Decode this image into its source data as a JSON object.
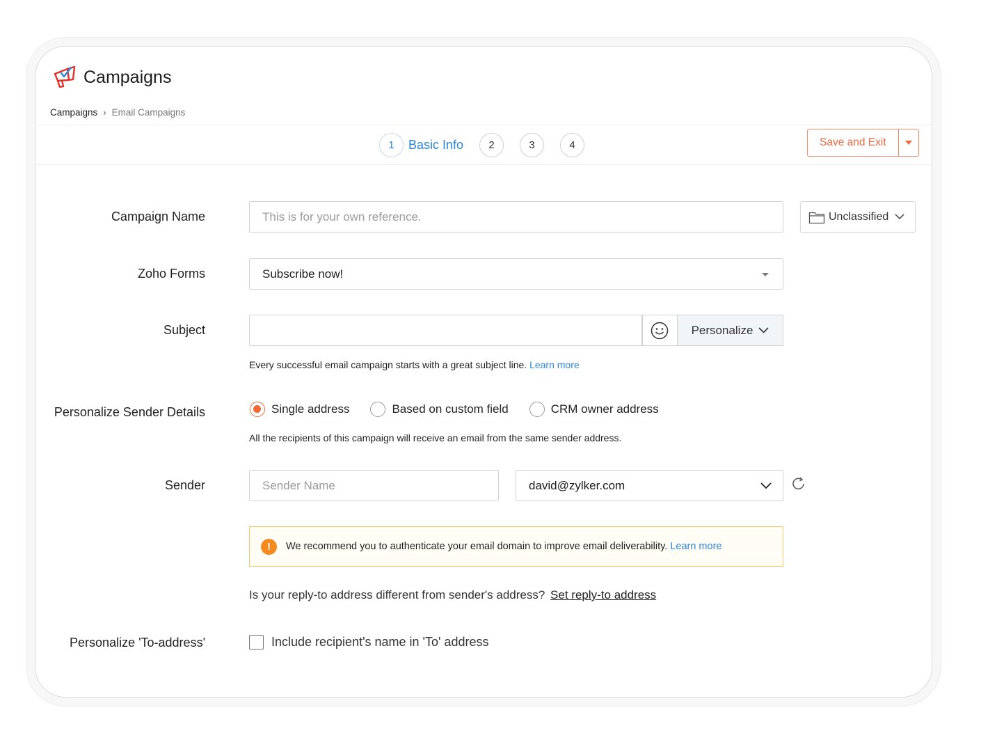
{
  "app": {
    "title": "Campaigns"
  },
  "breadcrumb": {
    "home": "Campaigns",
    "separator": "›",
    "current": "Email Campaigns"
  },
  "steps": [
    {
      "number": "1",
      "label": "Basic Info",
      "active": true
    },
    {
      "number": "2"
    },
    {
      "number": "3"
    },
    {
      "number": "4"
    }
  ],
  "toolbar": {
    "save_label": "Save and Exit"
  },
  "form": {
    "campaign_name": {
      "label": "Campaign Name",
      "placeholder": "This is for your own reference.",
      "folder": "Unclassified"
    },
    "zoho_forms": {
      "label": "Zoho Forms",
      "value": "Subscribe now!"
    },
    "subject": {
      "label": "Subject",
      "value": "",
      "personalize": "Personalize",
      "hint": "Every successful email campaign starts with a great subject line.",
      "hint_link": "Learn more"
    },
    "sender_details": {
      "label": "Personalize Sender Details",
      "options": [
        "Single address",
        "Based on custom field",
        "CRM owner address"
      ],
      "selected": "Single address",
      "hint": "All the recipients of this campaign will receive an email from the same sender address."
    },
    "sender": {
      "label": "Sender",
      "name_placeholder": "Sender Name",
      "email": "david@zylker.com"
    },
    "alert": {
      "text": "We recommend you to authenticate your email domain to improve email deliverability.",
      "link": "Learn more",
      "icon": "!"
    },
    "reply_to": {
      "question": "Is your reply-to address different from sender's address?",
      "link": "Set reply-to address"
    },
    "to_address": {
      "label": "Personalize 'To-address'",
      "checkbox_label": "Include recipient's name in 'To' address",
      "checked": false
    }
  },
  "colors": {
    "accent": "#2b86d6",
    "brand": "#ef6a42",
    "radio": "#f06a35",
    "warning": "#f68a1e"
  }
}
